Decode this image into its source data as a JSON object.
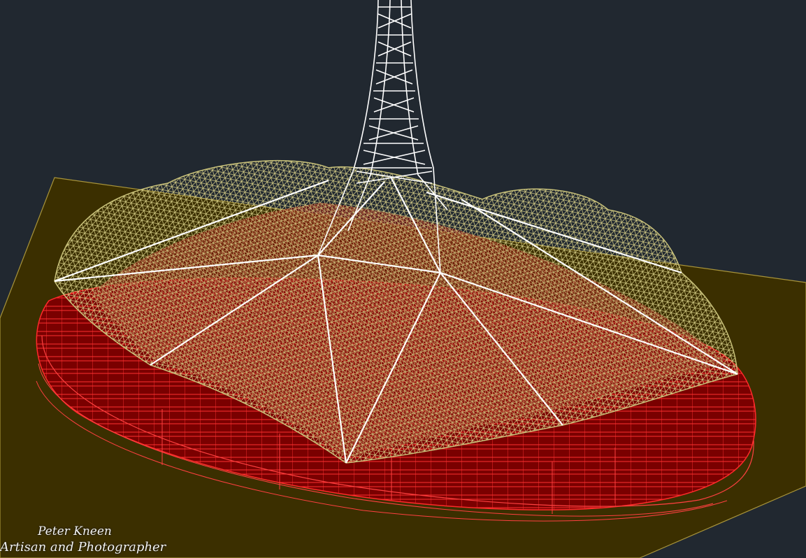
{
  "watermark": {
    "name": "Peter Kneen",
    "role": "Artisan and Photographer"
  },
  "colors": {
    "background": "#212830",
    "ground_plane": "#3b2f00",
    "ground_edge": "#a8943a",
    "red_body": "#7a0000",
    "red_lines": "#ff2a2a",
    "roof_mesh": "#c9c27a",
    "tower": "#ffffff"
  }
}
